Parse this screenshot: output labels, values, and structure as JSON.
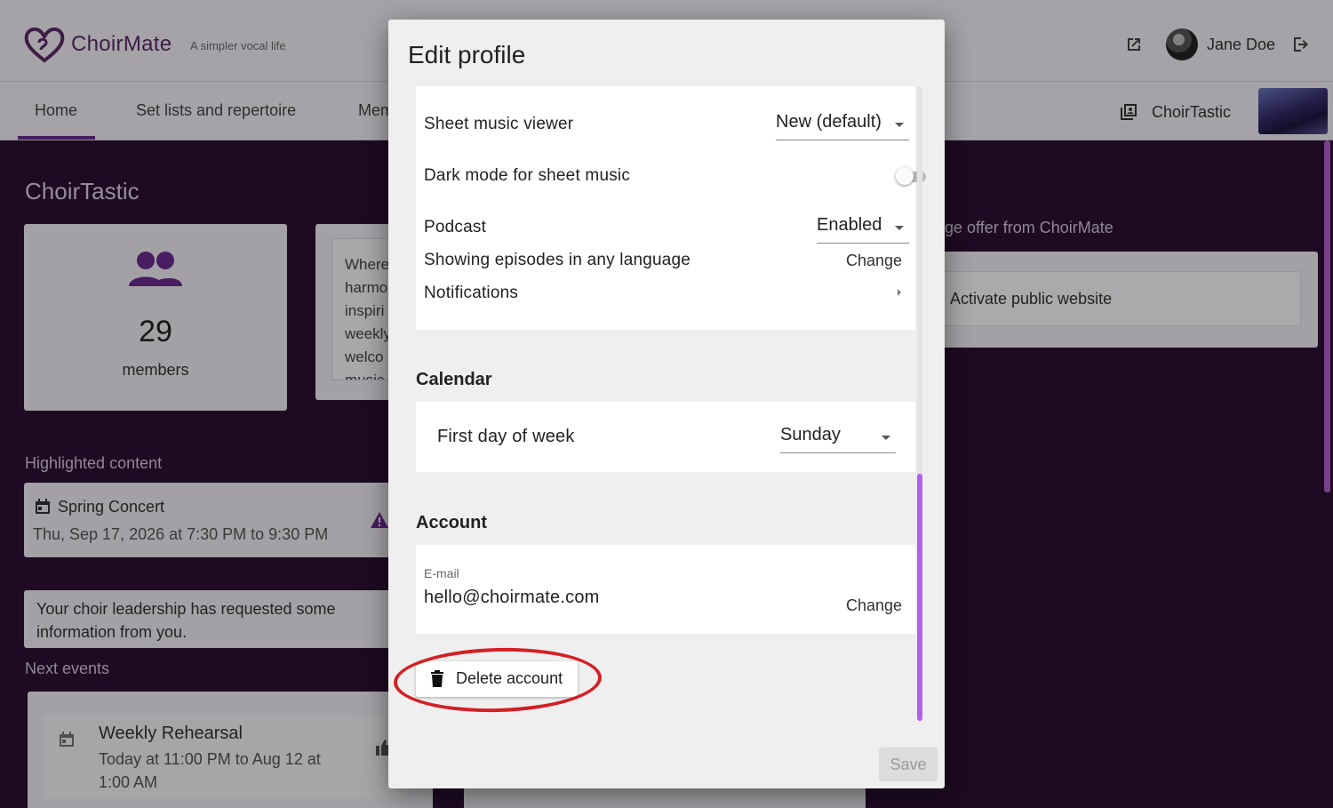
{
  "app": {
    "brand": "ChoirMate",
    "tagline": "A simpler vocal life",
    "user_name": "Jane Doe",
    "choir_name": "ChoirTastic",
    "accent_color": "#6b2b8f",
    "icons": [
      "heart-logo-icon",
      "external-link-icon",
      "logout-icon",
      "choir-library-icon"
    ]
  },
  "nav": {
    "tabs": [
      {
        "label": "Home",
        "active": true
      },
      {
        "label": "Set lists and repertoire"
      },
      {
        "label": "Mem"
      }
    ]
  },
  "dashboard": {
    "title": "ChoirTastic",
    "members_count": "29",
    "members_label": "members",
    "description_lines": [
      "Where",
      "harmo",
      "inspiri",
      "weekly",
      "welco",
      "music"
    ],
    "highlighted_label": "Highlighted content",
    "highlight": {
      "title": "Spring Concert",
      "time": "Thu, Sep 17, 2026 at 7:30 PM to 9:30 PM"
    },
    "info_request": "Your choir leadership has requested some information from you.",
    "next_events_label": "Next events",
    "next_event": {
      "title": "Weekly Rehearsal",
      "time_line1": "Today at 11:00 PM to Aug 12 at",
      "time_line2": "1:00 AM"
    },
    "offer_label": "ge offer from ChoirMate",
    "offer_button": "Activate public website"
  },
  "dialog": {
    "title": "Edit profile",
    "sheet_music_viewer": {
      "label": "Sheet music viewer",
      "value": "New (default)"
    },
    "dark_mode": {
      "label": "Dark mode for sheet music",
      "enabled": false
    },
    "podcast": {
      "label": "Podcast",
      "value": "Enabled"
    },
    "episodes": {
      "label": "Showing episodes in any language",
      "action": "Change"
    },
    "notifications": {
      "label": "Notifications"
    },
    "calendar": {
      "heading": "Calendar",
      "first_day": {
        "label": "First day of week",
        "value": "Sunday"
      }
    },
    "account": {
      "heading": "Account",
      "email_caption": "E-mail",
      "email": "hello@choirmate.com",
      "action": "Change"
    },
    "delete_button": "Delete account",
    "save_button": "Save",
    "annotation_color": "#d41f24"
  }
}
